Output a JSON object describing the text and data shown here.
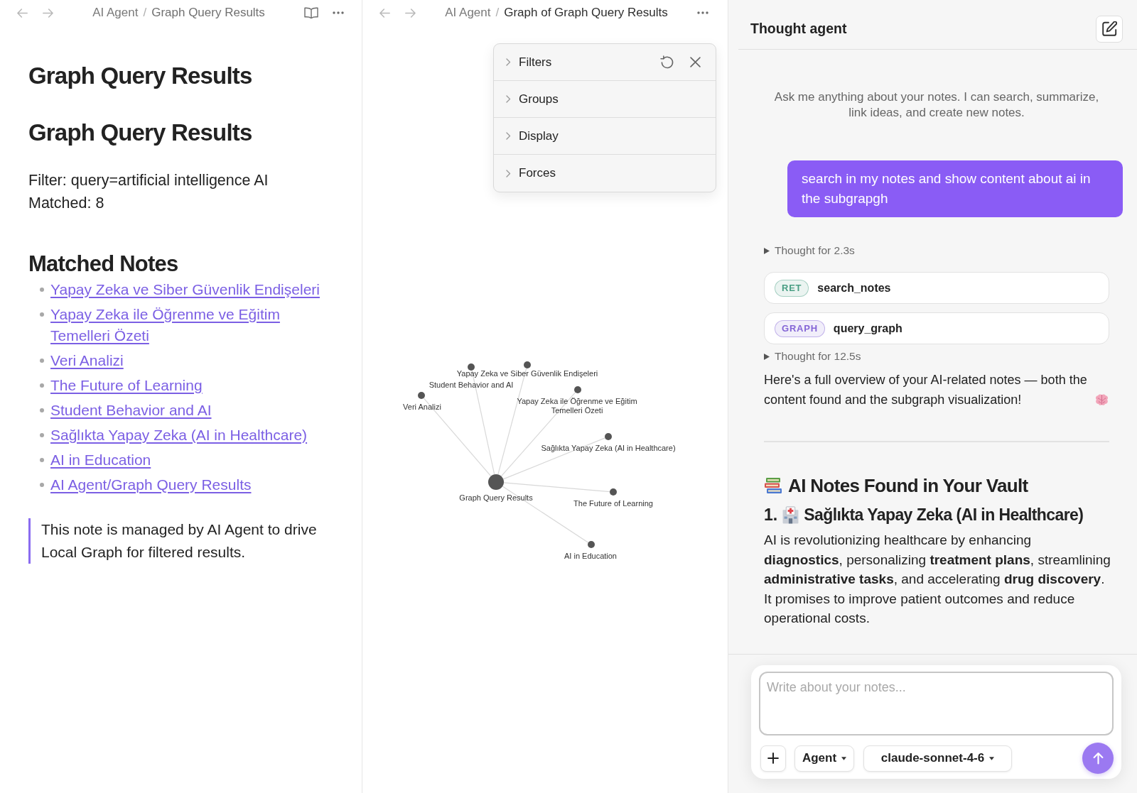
{
  "left_pane": {
    "focused": false,
    "nav_buttons": [
      {
        "kind": "back",
        "disabled": true
      },
      {
        "kind": "forward",
        "disabled": true
      }
    ],
    "breadcrumb": {
      "parent": "AI Agent",
      "separator": "/",
      "current": "Graph Query Results"
    },
    "actions": [
      {
        "kind": "reading-view"
      },
      {
        "kind": "more"
      }
    ],
    "note": {
      "blocks": [
        {
          "kind": "h1",
          "text": "Graph Query Results"
        },
        {
          "kind": "h1",
          "text": "Graph Query Results"
        },
        {
          "kind": "lines",
          "lines": [
            "Filter: query=artificial intelligence AI",
            "Matched: 8"
          ]
        },
        {
          "kind": "h2",
          "text": "Matched Notes"
        },
        {
          "kind": "links",
          "items": [
            "Yapay Zeka ve Siber Güvenlik Endişeleri",
            "Yapay Zeka ile Öğrenme ve Eğitim Temelleri Özeti",
            "Veri Analizi",
            "The Future of Learning",
            "Student Behavior and AI",
            "Sağlıkta Yapay Zeka (AI in Healthcare)",
            "AI in Education",
            "AI Agent/Graph Query Results"
          ]
        },
        {
          "kind": "quote",
          "text": "This note is managed by AI Agent to drive Local Graph for filtered results."
        }
      ]
    }
  },
  "middle_pane": {
    "focused": true,
    "nav_buttons": [
      {
        "kind": "back",
        "disabled": true
      },
      {
        "kind": "forward",
        "disabled": true
      }
    ],
    "breadcrumb": {
      "parent": "AI Agent",
      "separator": "/",
      "current": "Graph of Graph Query Results"
    },
    "actions": [
      {
        "kind": "more"
      }
    ],
    "graph_settings": {
      "sections": [
        {
          "label": "Filters",
          "expanded": false
        },
        {
          "label": "Groups",
          "expanded": false
        },
        {
          "label": "Display",
          "expanded": false
        },
        {
          "label": "Forces",
          "expanded": false
        }
      ],
      "actions": [
        {
          "kind": "reset"
        },
        {
          "kind": "close"
        }
      ]
    },
    "graph": {
      "nodes": [
        {
          "label": "Graph Query Results",
          "kind": "center"
        },
        {
          "label": "Student Behavior and AI",
          "kind": "note"
        },
        {
          "label": "Yapay Zeka ve Siber Güvenlik Endişeleri",
          "kind": "note"
        },
        {
          "label": "Veri Analizi",
          "kind": "note"
        },
        {
          "label": "Yapay Zeka ile Öğrenme ve Eğitim Temelleri Özeti",
          "kind": "note"
        },
        {
          "label": "Sağlıkta Yapay Zeka (AI in Healthcare)",
          "kind": "note"
        },
        {
          "label": "The Future of Learning",
          "kind": "note"
        },
        {
          "label": "AI in Education",
          "kind": "note"
        }
      ]
    }
  },
  "right_pane": {
    "header": {
      "title": "Thought agent"
    },
    "intro": "Ask me anything about your notes. I can search, summarize, link ideas, and create new notes.",
    "messages": [
      {
        "kind": "user",
        "text": "search in my notes and show content about ai in the subgrapgh"
      },
      {
        "kind": "thought",
        "text": "Thought for 2.3s",
        "expanded": false
      },
      {
        "kind": "tool",
        "badge": "RET",
        "name": "search_notes",
        "color": "#4a9f84"
      },
      {
        "kind": "tool",
        "badge": "GRAPH",
        "name": "query_graph",
        "color": "#8465d6"
      },
      {
        "kind": "thought",
        "text": "Thought for 12.5s",
        "expanded": false
      },
      {
        "kind": "answer",
        "text": "Here's a full overview of your AI-related notes — both the content found and the subgraph visualization!"
      },
      {
        "kind": "divider"
      },
      {
        "kind": "heading",
        "text": "AI Notes Found in Your Vault"
      },
      {
        "kind": "note-heading",
        "number": "1.",
        "text": "Sağlıkta Yapay Zeka (AI in Healthcare)"
      },
      {
        "kind": "paragraph",
        "text": "AI is revolutionizing healthcare by enhancing **diagnostics**, personalizing **treatment plans**, streamlining **administrative tasks**, and accelerating **drug discovery**. It promises to improve patient outcomes and reduce operational costs."
      }
    ],
    "composer": {
      "placeholder": "Write about your notes...",
      "mode": "Agent",
      "model": "claude-sonnet-4-6"
    }
  }
}
